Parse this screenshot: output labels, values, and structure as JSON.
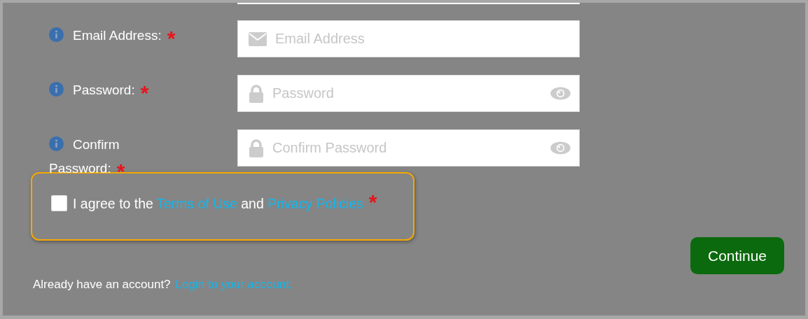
{
  "fields": [
    {
      "label": "Email Address:",
      "required_mark": "*",
      "kind": "email",
      "placeholder": "Email Address"
    },
    {
      "label": "Password:",
      "required_mark": "*",
      "kind": "password",
      "placeholder": "Password"
    },
    {
      "label": "Confirm Password:",
      "required_mark": "*",
      "kind": "password",
      "placeholder": "Confirm Password"
    }
  ],
  "agreement": {
    "checked": false,
    "text_before": "I agree to the",
    "terms_link": "Terms of Use",
    "conjunction": "and",
    "privacy_link": "Privacy Policies",
    "required_mark": "*"
  },
  "continue_button": "Continue",
  "footer": {
    "prompt": "Already have an account?",
    "link": "Login to your account."
  }
}
